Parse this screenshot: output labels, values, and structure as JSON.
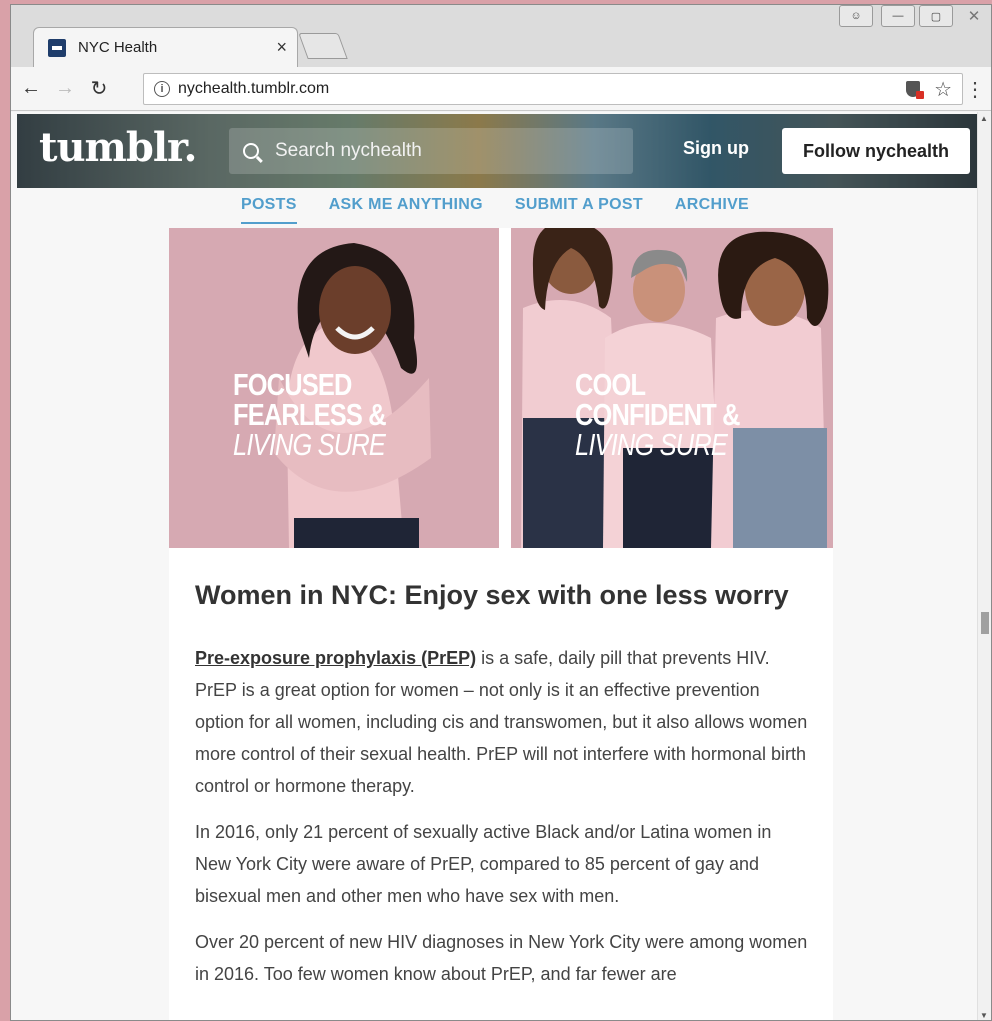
{
  "browser": {
    "tab_title": "NYC Health",
    "tab_close": "×",
    "url": "nychealth.tumblr.com",
    "win_user": "&#9817;",
    "win_minimize": "—",
    "win_maximize": "▢",
    "win_close": "✕"
  },
  "header": {
    "logo": "tumblr.",
    "search_placeholder": "Search nychealth",
    "signup": "Sign up",
    "follow": "Follow nychealth"
  },
  "nav": {
    "items": [
      "POSTS",
      "ASK ME ANYTHING",
      "SUBMIT A POST",
      "ARCHIVE"
    ],
    "active": "POSTS"
  },
  "photos": {
    "left": {
      "line1": "FOCUSED",
      "line2": "FEARLESS &",
      "line3": "LIVING SURE"
    },
    "right": {
      "line1": "COOL",
      "line2": "CONFIDENT &",
      "line3": "LIVING SURE"
    }
  },
  "post": {
    "title": "Women in NYC: Enjoy sex with one less worry",
    "link_text": "Pre-exposure prophylaxis (PrEP)",
    "p1_rest": " is a safe, daily pill that prevents HIV. PrEP is a great option for women – not only is it an effective prevention option for all women, including cis and transwomen, but it also allows women more control of their sexual health. PrEP will not interfere with hormonal birth control or hormone therapy.",
    "p2": "In 2016, only 21 percent of sexually active Black and/or Latina women in New York City were aware of PrEP, compared to 85 percent of gay and bisexual men and other men who have sex with men.",
    "p3": "Over 20 percent of new HIV diagnoses in New York City were among women in 2016. Too few women know about PrEP, and far fewer are"
  },
  "colors": {
    "nav_blue": "#529ecc",
    "photo_pink": "#d6a9b2",
    "desktop_pink": "#d9a1a8"
  }
}
